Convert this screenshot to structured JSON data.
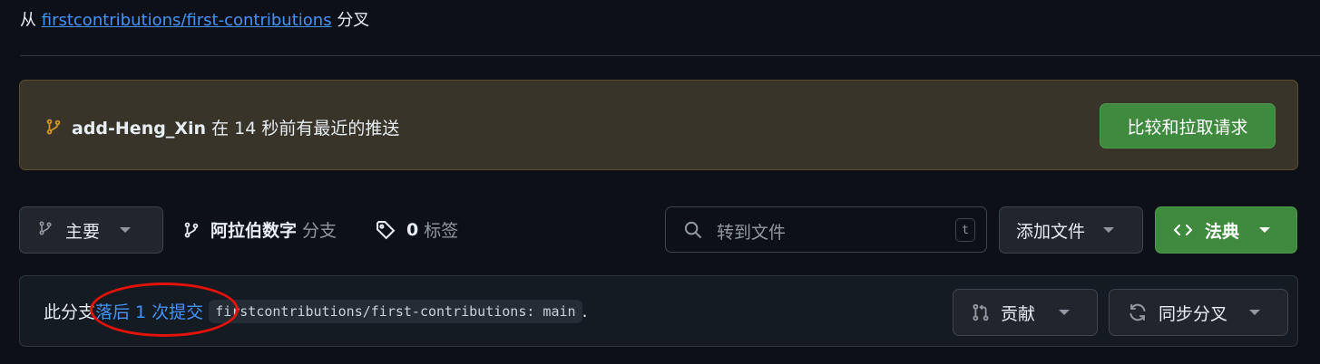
{
  "fork_info": {
    "prefix": "从",
    "repo_link": "firstcontributions/first-contributions",
    "suffix": "分叉"
  },
  "push_banner": {
    "icon": "git-branch-icon",
    "branch": "add-Heng_Xin",
    "message": "在 14 秒前有最近的推送",
    "compare_button": "比较和拉取请求"
  },
  "toolbar": {
    "branch_selector": "主要",
    "branches_count": "阿拉伯数字",
    "branches_label": "分支",
    "tags_count": "0",
    "tags_label": "标签",
    "search_placeholder": "转到文件",
    "search_shortcut": "t",
    "add_file_button": "添加文件",
    "code_button": "法典"
  },
  "branch_status": {
    "prefix": "此分支",
    "behind_link": "落后 1 次提交",
    "ref": "firstcontributions/first-contributions: main",
    "end": ".",
    "contribute_button": "贡献",
    "sync_button": "同步分叉"
  },
  "colors": {
    "background": "#0d1117",
    "link": "#4493f8",
    "primary_button": "#3f8a3f",
    "banner_bg": "#38342a",
    "annotation": "#e3120b"
  }
}
